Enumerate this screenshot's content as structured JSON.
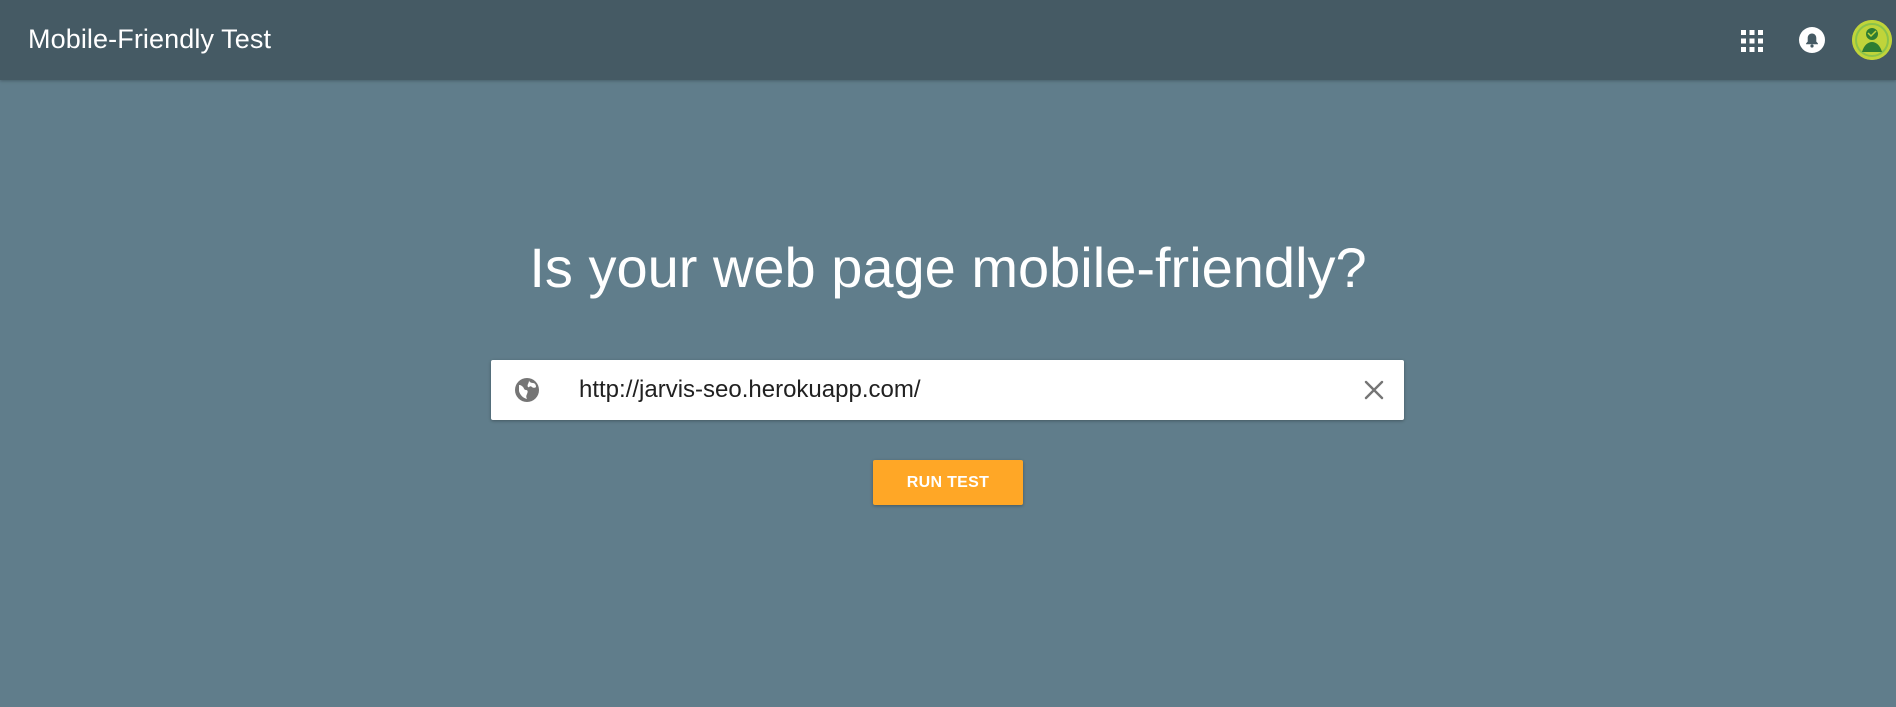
{
  "header": {
    "title": "Mobile-Friendly Test",
    "icons": [
      "apps-icon",
      "notifications-icon",
      "avatar"
    ]
  },
  "main": {
    "headline": "Is your web page mobile-friendly?",
    "url_input": {
      "value": "http://jarvis-seo.herokuapp.com/",
      "leading_icon": "globe-icon",
      "trailing_icon": "clear-icon"
    },
    "run_button_label": "RUN TEST"
  },
  "colors": {
    "header_bg": "#455a64",
    "page_bg": "#607d8b",
    "button_bg": "#ffa726",
    "input_bg": "#ffffff"
  }
}
